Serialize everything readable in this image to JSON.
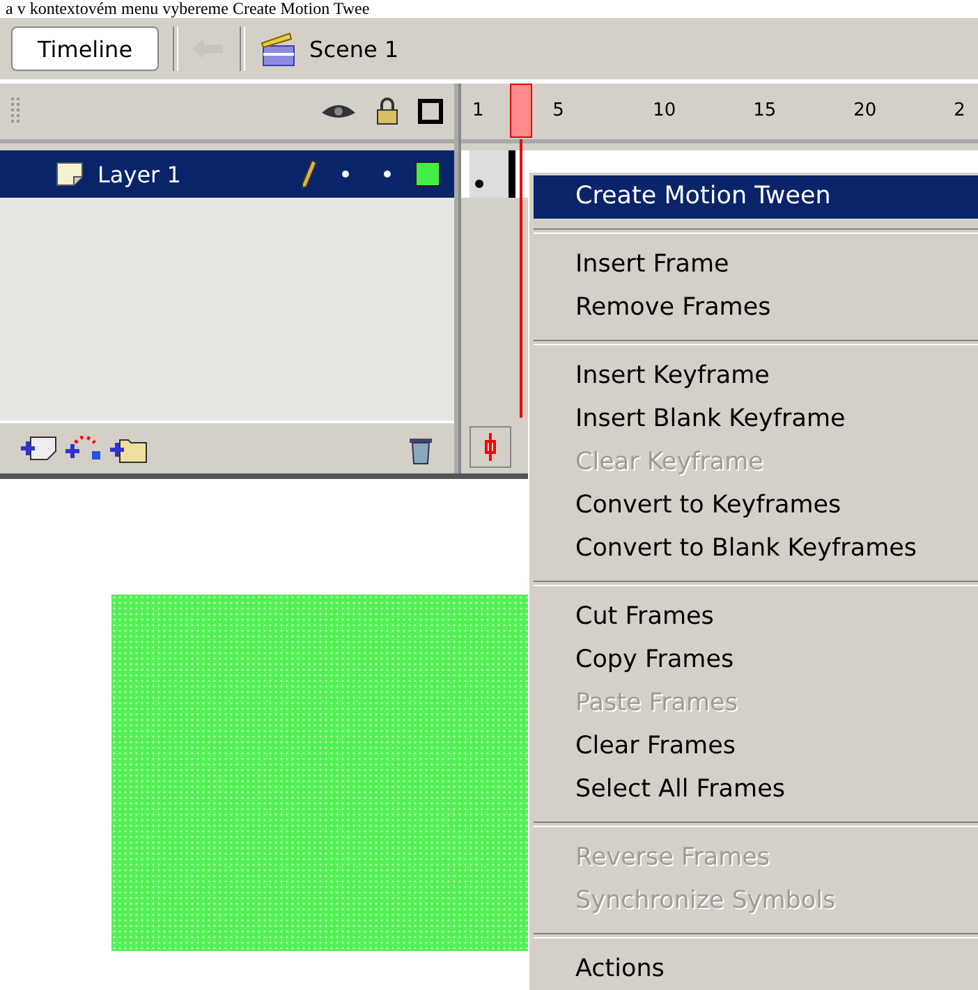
{
  "caption": "a v kontextovém menu vybereme Create Motion Twee",
  "toolbar": {
    "timeline_button": "Timeline",
    "scene": "Scene 1"
  },
  "ruler": [
    "1",
    "5",
    "10",
    "15",
    "20",
    "2"
  ],
  "layers": [
    {
      "name": "Layer 1",
      "selected": true
    }
  ],
  "context_menu": [
    {
      "kind": "item",
      "label": "Create Motion Tween",
      "selected": true,
      "disabled": false
    },
    {
      "kind": "separator"
    },
    {
      "kind": "item",
      "label": "Insert Frame",
      "selected": false,
      "disabled": false
    },
    {
      "kind": "item",
      "label": "Remove Frames",
      "selected": false,
      "disabled": false
    },
    {
      "kind": "separator"
    },
    {
      "kind": "item",
      "label": "Insert Keyframe",
      "selected": false,
      "disabled": false
    },
    {
      "kind": "item",
      "label": "Insert Blank Keyframe",
      "selected": false,
      "disabled": false
    },
    {
      "kind": "item",
      "label": "Clear Keyframe",
      "selected": false,
      "disabled": true
    },
    {
      "kind": "item",
      "label": "Convert to Keyframes",
      "selected": false,
      "disabled": false
    },
    {
      "kind": "item",
      "label": "Convert to Blank Keyframes",
      "selected": false,
      "disabled": false
    },
    {
      "kind": "separator"
    },
    {
      "kind": "item",
      "label": "Cut Frames",
      "selected": false,
      "disabled": false
    },
    {
      "kind": "item",
      "label": "Copy Frames",
      "selected": false,
      "disabled": false
    },
    {
      "kind": "item",
      "label": "Paste Frames",
      "selected": false,
      "disabled": true
    },
    {
      "kind": "item",
      "label": "Clear Frames",
      "selected": false,
      "disabled": false
    },
    {
      "kind": "item",
      "label": "Select All Frames",
      "selected": false,
      "disabled": false
    },
    {
      "kind": "separator"
    },
    {
      "kind": "item",
      "label": "Reverse Frames",
      "selected": false,
      "disabled": true
    },
    {
      "kind": "item",
      "label": "Synchronize Symbols",
      "selected": false,
      "disabled": true
    },
    {
      "kind": "separator"
    },
    {
      "kind": "item",
      "label": "Actions",
      "selected": false,
      "disabled": false
    }
  ]
}
